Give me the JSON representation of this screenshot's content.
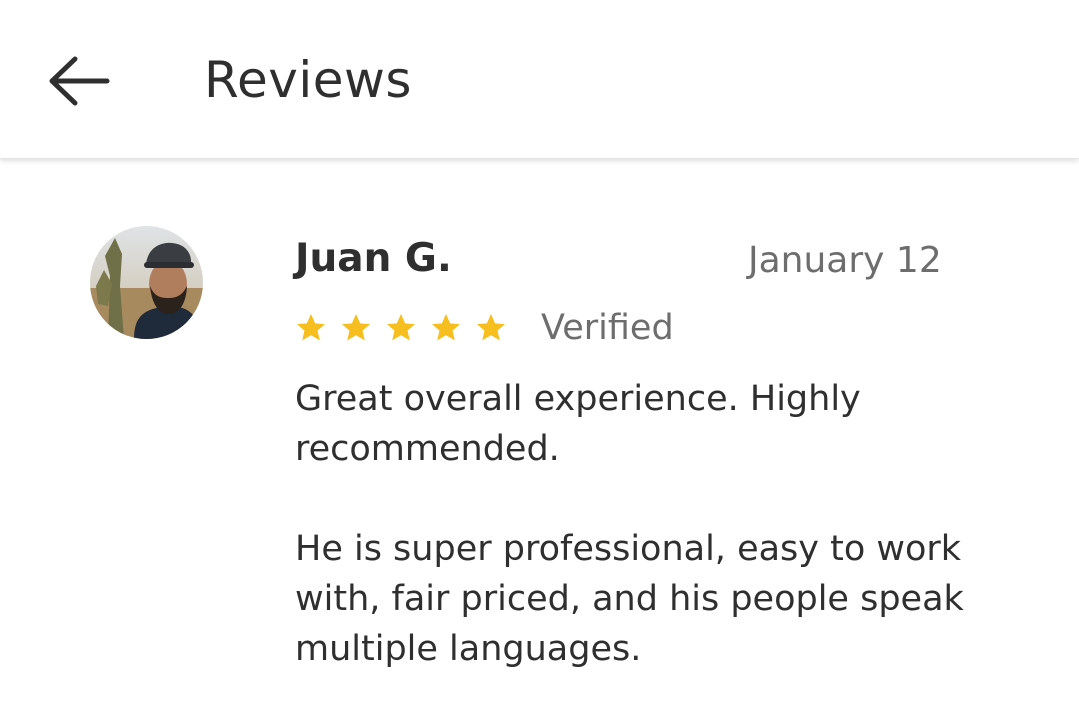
{
  "header": {
    "title": "Reviews",
    "back_icon": "arrow-left-icon"
  },
  "review": {
    "reviewer_name": "Juan G.",
    "date": "January 12",
    "rating": 5,
    "rating_max": 5,
    "verified_label": "Verified",
    "paragraphs": [
      "Great overall experience. Highly recommended.",
      "He is super professional, easy to work with, fair priced, and his people speak multiple languages."
    ],
    "avatar_icon": "user-photo"
  },
  "colors": {
    "star": "#F6BE1E",
    "text_primary": "#2F2F2F",
    "text_secondary": "#6D6D6D"
  }
}
